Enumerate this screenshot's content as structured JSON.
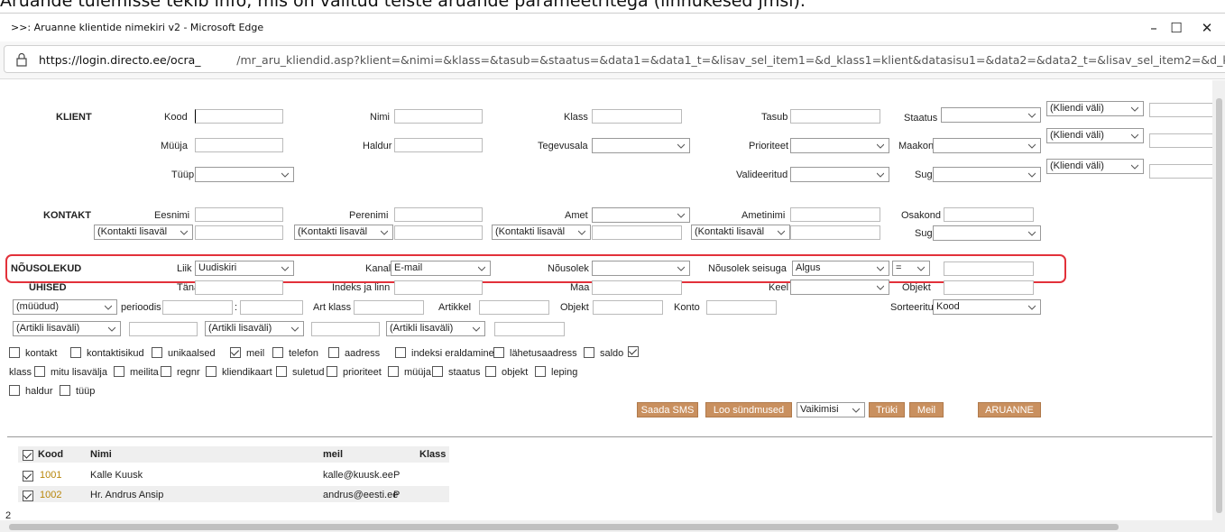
{
  "caption": "Aruande tulemisse tekib info, mis on valitud teiste aruande parameetritega (linnukesed jmsi).",
  "window": {
    "title": ">>: Aruanne klientide nimekiri v2 - Microsoft Edge",
    "minimize": "–",
    "maximize": "☐",
    "close": "✕"
  },
  "url": {
    "host": "https://login.directo.ee/ocra_",
    "path": "/mr_aru_kliendid.asp?klient=&nimi=&klass=&tasub=&staatus=&data1=&data1_t=&lisav_sel_item1=&d_klass1=klient&datasisu1=&data2=&data2_t=&lisav_sel_item2=&d_klass"
  },
  "klient": {
    "section": "KLIENT",
    "kood": "Kood",
    "nimi": "Nimi",
    "klass": "Klass",
    "tasub": "Tasub",
    "staatus": "Staatus",
    "myyja": "Müüja",
    "haldur": "Haldur",
    "tegevusala": "Tegevusala",
    "prioriteet": "Prioriteet",
    "maakond": "Maakond",
    "tyyp": "Tüüp",
    "valideeritud": "Valideeritud",
    "sugu": "Sugu",
    "kliendi_vali": "(Kliendi väli)"
  },
  "kontakt": {
    "section": "KONTAKT",
    "eesnimi": "Eesnimi",
    "perenimi": "Perenimi",
    "amet": "Amet",
    "ametinimi": "Ametinimi",
    "osakond": "Osakond",
    "sugu": "Sugu",
    "lisaval": "(Kontakti lisaväl"
  },
  "nousolekud": {
    "section": "NÕUSOLEKUD",
    "liik": "Liik",
    "liik_value": "Uudiskiri",
    "kanal": "Kanal",
    "kanal_value": "E-mail",
    "nousolek": "Nõusolek",
    "seisuga": "Nõusolek seisuga",
    "seisuga_value": "Algus",
    "op_value": "="
  },
  "uhised": {
    "section": "ÜHISED",
    "tanav": "Tänav",
    "indeks": "Indeks ja linn",
    "maa": "Maa",
    "keel": "Keel",
    "objekt": "Objekt",
    "myydud": "(müüdud)",
    "perioodis": "perioodis",
    "date_sep": ":",
    "art_klass": "Art klass",
    "artikkel": "Artikkel",
    "objekt2": "Objekt",
    "konto": "Konto",
    "sorteeritud": "Sorteeritud",
    "sort_value": "Kood",
    "artikli_lisavali": "(Artikli lisaväli)"
  },
  "checkboxes": [
    {
      "label": "kontakt",
      "checked": false
    },
    {
      "label": "kontaktisikud",
      "checked": false
    },
    {
      "label": "unikaalsed",
      "checked": false
    },
    {
      "label": "meil",
      "checked": true
    },
    {
      "label": "telefon",
      "checked": false
    },
    {
      "label": "aadress",
      "checked": false
    },
    {
      "label": "indeksi eraldamine",
      "checked": false
    },
    {
      "label": "lähetusaadress",
      "checked": false
    },
    {
      "label": "saldo",
      "checked": true
    },
    {
      "label": "klass",
      "checked": false
    },
    {
      "label": "mitu lisavälja",
      "checked": false
    },
    {
      "label": "meilita",
      "checked": false
    },
    {
      "label": "regnr",
      "checked": false
    },
    {
      "label": "kliendikaart",
      "checked": false
    },
    {
      "label": "suletud",
      "checked": false
    },
    {
      "label": "prioriteet",
      "checked": false
    },
    {
      "label": "müüja",
      "checked": false
    },
    {
      "label": "staatus",
      "checked": false
    },
    {
      "label": "objekt",
      "checked": false
    },
    {
      "label": "leping",
      "checked": false
    },
    {
      "label": "haldur",
      "checked": false
    },
    {
      "label": "tüüp",
      "checked": false
    }
  ],
  "actions": {
    "saada_sms": "Saada SMS",
    "loo_syndmused": "Loo sündmused",
    "vaikimisi": "Vaikimisi",
    "tryki": "Trüki",
    "meil": "Meil",
    "aruanne": "ARUANNE"
  },
  "results": {
    "headers": [
      "Kood",
      "Nimi",
      "meil",
      "Klass"
    ],
    "rows": [
      {
        "kood": "1001",
        "nimi": "Kalle Kuusk",
        "meil": "kalle@kuusk.ee",
        "klass": "P"
      },
      {
        "kood": "1002",
        "nimi": "Hr. Andrus Ansip",
        "meil": "andrus@eesti.ee",
        "klass": "P"
      }
    ],
    "count": "2"
  },
  "colors": {
    "accent_button": "#c9905f",
    "link": "#b8860b",
    "highlight": "#e2313a"
  }
}
